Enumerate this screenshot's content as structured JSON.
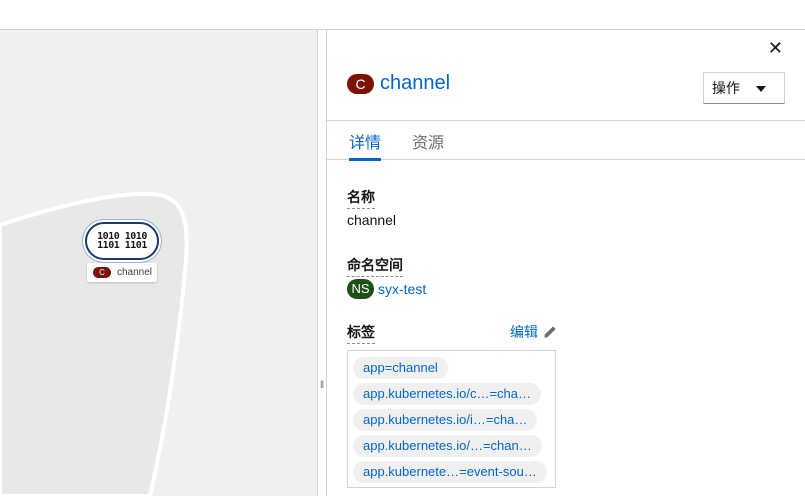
{
  "topology": {
    "node_label": "channel",
    "node_badge": "C",
    "node_icon_text": [
      "1010 1010",
      "1101 1101"
    ]
  },
  "panel": {
    "close_label": "✕",
    "resource_badge": "C",
    "resource_name": "channel",
    "actions_label": "操作",
    "tabs": [
      {
        "label": "详情",
        "active": true
      },
      {
        "label": "资源",
        "active": false
      }
    ],
    "details": {
      "name_label": "名称",
      "name_value": "channel",
      "namespace_label": "命名空间",
      "namespace_badge": "NS",
      "namespace_value": "syx-test",
      "labels_label": "标签",
      "edit_label": "编辑",
      "labels": [
        "app=channel",
        "app.kubernetes.io/c…=cha…",
        "app.kubernetes.io/i…=cha…",
        "app.kubernetes.io/…=chan…",
        "app.kubernete…=event-sou…"
      ]
    }
  },
  "colors": {
    "accent": "#0066cc",
    "channel_badge": "#7d1007",
    "namespace_badge": "#1e4f18"
  }
}
